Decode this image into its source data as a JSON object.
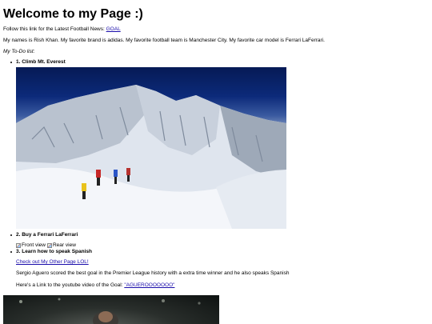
{
  "page": {
    "title": "Welcome to my Page :)",
    "follow_text": "Follow this link for the Latest Football News: ",
    "follow_link": "GOAL",
    "about": "My names is Rish Khan. My favorite brand is adidas. My favorite football team is Manchester City. My favorite car model is Ferrari LaFerrari.",
    "todo_heading": "My To-Do list:"
  },
  "todo": [
    {
      "title": "1. Climb Mt. Everest"
    },
    {
      "title": "2. Buy a Ferrari LaFerrari",
      "images": [
        "Front view",
        "Rear view"
      ]
    },
    {
      "title": "3. Learn how to speak Spanish",
      "other_page_link": "Check out My Other Page LOL!",
      "aguero_text": "Sergio Aguero scored the best goal in the Premier League history with a extra time winner and he also speaks Spanish",
      "youtube_text": "Here's a Link to the youtube video of the Goal: ",
      "youtube_link": "\"AGUEROOOOOOO\""
    }
  ],
  "colors": {
    "link": "#1a0dab",
    "text": "#000000",
    "background": "#ffffff"
  }
}
